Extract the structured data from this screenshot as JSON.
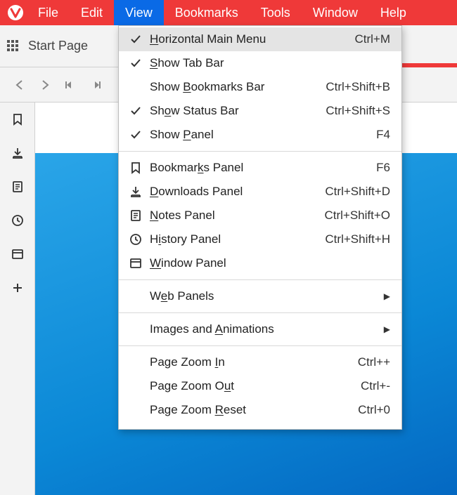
{
  "menubar": {
    "items": [
      {
        "label": "File"
      },
      {
        "label": "Edit"
      },
      {
        "label": "View"
      },
      {
        "label": "Bookmarks"
      },
      {
        "label": "Tools"
      },
      {
        "label": "Window"
      },
      {
        "label": "Help"
      }
    ],
    "active_index": 2
  },
  "tab": {
    "title": "Start Page"
  },
  "dropdown": {
    "items": [
      {
        "kind": "item",
        "label_pre": "",
        "mnemonic": "H",
        "label_post": "orizontal Main Menu",
        "shortcut": "Ctrl+M",
        "icon": "check",
        "highlight": true
      },
      {
        "kind": "item",
        "label_pre": "",
        "mnemonic": "S",
        "label_post": "how Tab Bar",
        "shortcut": "",
        "icon": "check"
      },
      {
        "kind": "item",
        "label_pre": "Show ",
        "mnemonic": "B",
        "label_post": "ookmarks Bar",
        "shortcut": "Ctrl+Shift+B",
        "icon": ""
      },
      {
        "kind": "item",
        "label_pre": "Sh",
        "mnemonic": "o",
        "label_post": "w Status Bar",
        "shortcut": "Ctrl+Shift+S",
        "icon": "check"
      },
      {
        "kind": "item",
        "label_pre": "Show ",
        "mnemonic": "P",
        "label_post": "anel",
        "shortcut": "F4",
        "icon": "check"
      },
      {
        "kind": "sep"
      },
      {
        "kind": "item",
        "label_pre": "Bookmar",
        "mnemonic": "k",
        "label_post": "s Panel",
        "shortcut": "F6",
        "icon": "bookmark"
      },
      {
        "kind": "item",
        "label_pre": "",
        "mnemonic": "D",
        "label_post": "ownloads Panel",
        "shortcut": "Ctrl+Shift+D",
        "icon": "download"
      },
      {
        "kind": "item",
        "label_pre": "",
        "mnemonic": "N",
        "label_post": "otes Panel",
        "shortcut": "Ctrl+Shift+O",
        "icon": "notes"
      },
      {
        "kind": "item",
        "label_pre": "H",
        "mnemonic": "i",
        "label_post": "story Panel",
        "shortcut": "Ctrl+Shift+H",
        "icon": "clock"
      },
      {
        "kind": "item",
        "label_pre": "",
        "mnemonic": "W",
        "label_post": "indow Panel",
        "shortcut": "",
        "icon": "window"
      },
      {
        "kind": "sep"
      },
      {
        "kind": "submenu",
        "label_pre": "W",
        "mnemonic": "e",
        "label_post": "b Panels",
        "icon": ""
      },
      {
        "kind": "sep"
      },
      {
        "kind": "submenu",
        "label_pre": "Images and ",
        "mnemonic": "A",
        "label_post": "nimations",
        "icon": ""
      },
      {
        "kind": "sep"
      },
      {
        "kind": "item",
        "label_pre": "Page Zoom ",
        "mnemonic": "I",
        "label_post": "n",
        "shortcut": "Ctrl++",
        "icon": ""
      },
      {
        "kind": "item",
        "label_pre": "Page Zoom O",
        "mnemonic": "u",
        "label_post": "t",
        "shortcut": "Ctrl+-",
        "icon": ""
      },
      {
        "kind": "item",
        "label_pre": "Page Zoom ",
        "mnemonic": "R",
        "label_post": "eset",
        "shortcut": "Ctrl+0",
        "icon": ""
      }
    ]
  }
}
